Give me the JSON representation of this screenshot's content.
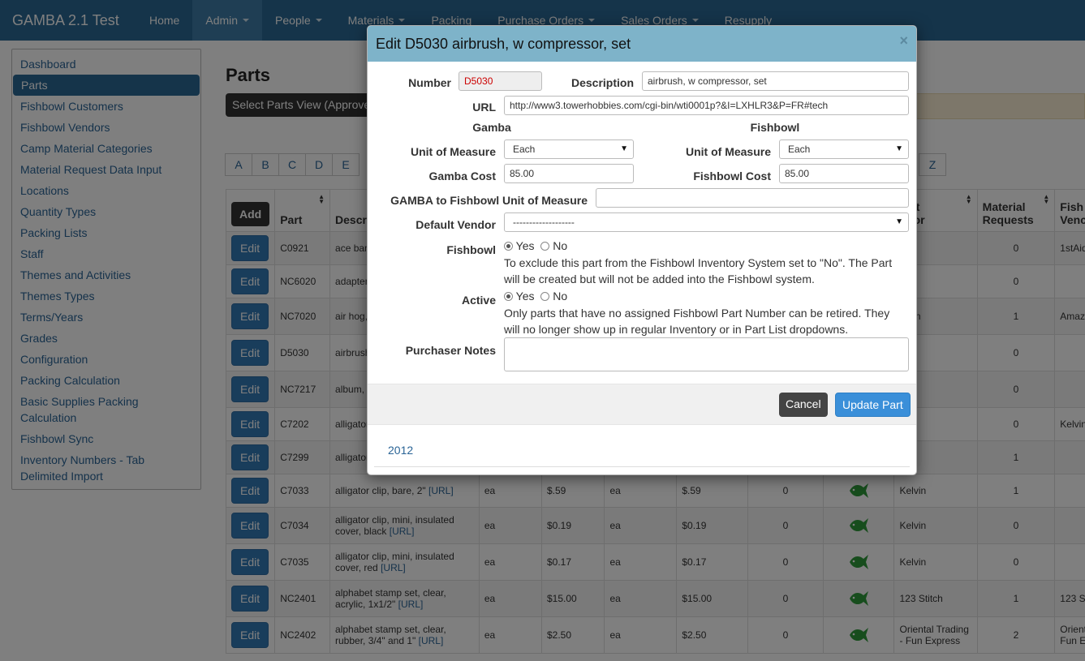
{
  "app": {
    "title": "GAMBA 2.1 Test"
  },
  "nav": [
    {
      "label": "Home",
      "caret": false,
      "active": false
    },
    {
      "label": "Admin",
      "caret": true,
      "active": true
    },
    {
      "label": "People",
      "caret": true,
      "active": false
    },
    {
      "label": "Materials",
      "caret": true,
      "active": false
    },
    {
      "label": "Packing",
      "caret": false,
      "active": false
    },
    {
      "label": "Purchase Orders",
      "caret": true,
      "active": false
    },
    {
      "label": "Sales Orders",
      "caret": true,
      "active": false
    },
    {
      "label": "Resupply",
      "caret": false,
      "active": false
    }
  ],
  "sidebar": [
    "Dashboard",
    "Parts",
    "Fishbowl Customers",
    "Fishbowl Vendors",
    "Camp Material Categories",
    "Material Request Data Input",
    "Locations",
    "Quantity Types",
    "Packing Lists",
    "Staff",
    "Themes and Activities",
    "Themes Types",
    "Terms/Years",
    "Grades",
    "Configuration",
    "Packing Calculation",
    "Basic Supplies Packing Calculation",
    "Fishbowl Sync",
    "Inventory Numbers - Tab Delimited Import"
  ],
  "sidebar_active": "Parts",
  "main": {
    "title": "Parts",
    "view_label": "Select Parts View (Approve",
    "letters": [
      "A",
      "B",
      "C",
      "D",
      "E"
    ],
    "letter_last": "Z"
  },
  "table": {
    "add_label": "Add",
    "edit_label": "Edit",
    "url_label": "[URL]",
    "headers": [
      "Part",
      "Descrip",
      "",
      "",
      "",
      "",
      "",
      "",
      "ault\nndor",
      "Material\nRequests",
      "Fish\nVenc"
    ],
    "rows": [
      {
        "part": "C0921",
        "desc": "ace band",
        "u1": "",
        "c1": "",
        "u2": "",
        "c2": "",
        "q": "",
        "fish": false,
        "vendor": "",
        "req": "0",
        "fv": "1stAid"
      },
      {
        "part": "NC6020",
        "desc": "adapter,",
        "u1": "",
        "c1": "",
        "u2": "",
        "c2": "",
        "q": "",
        "fish": false,
        "vendor": "",
        "req": "0",
        "fv": ""
      },
      {
        "part": "NC7020",
        "desc": "air hog, s",
        "u1": "",
        "c1": "",
        "u2": "",
        "c2": "",
        "q": "",
        "fish": false,
        "vendor": "azon",
        "req": "1",
        "fv": "Amaz"
      },
      {
        "part": "D5030",
        "desc": "airbrush,",
        "url": true,
        "u1": "",
        "c1": "",
        "u2": "",
        "c2": "",
        "q": "",
        "fish": false,
        "vendor": "",
        "req": "0",
        "fv": ""
      },
      {
        "part": "NC7217",
        "desc": "album, p",
        "url": true,
        "u1": "",
        "c1": "",
        "u2": "",
        "c2": "",
        "q": "",
        "fish": false,
        "vendor": "",
        "req": "0",
        "fv": ""
      },
      {
        "part": "C7202",
        "desc": "alligator",
        "u1": "",
        "c1": "",
        "u2": "",
        "c2": "",
        "q": "",
        "fish": false,
        "vendor": "",
        "req": "0",
        "fv": "Kelvin"
      },
      {
        "part": "C7299",
        "desc": "alligator",
        "u1": "",
        "c1": "",
        "u2": "",
        "c2": "",
        "q": "",
        "fish": false,
        "vendor": "lvin",
        "req": "1",
        "fv": ""
      },
      {
        "part": "C7033",
        "desc": "alligator clip, bare, 2\"",
        "url": true,
        "u1": "ea",
        "c1": "$.59",
        "u2": "ea",
        "c2": "$.59",
        "q": "0",
        "fish": true,
        "vendor": "Kelvin",
        "req": "1",
        "fv": ""
      },
      {
        "part": "C7034",
        "desc": "alligator clip, mini, insulated cover, black",
        "url": true,
        "u1": "ea",
        "c1": "$0.19",
        "u2": "ea",
        "c2": "$0.19",
        "q": "0",
        "fish": true,
        "vendor": "Kelvin",
        "req": "0",
        "fv": ""
      },
      {
        "part": "C7035",
        "desc": "alligator clip, mini, insulated cover, red",
        "url": true,
        "u1": "ea",
        "c1": "$0.17",
        "u2": "ea",
        "c2": "$0.17",
        "q": "0",
        "fish": true,
        "vendor": "Kelvin",
        "req": "0",
        "fv": ""
      },
      {
        "part": "NC2401",
        "desc": "alphabet stamp set, clear, acrylic, 1x1/2\"",
        "url": true,
        "u1": "ea",
        "c1": "$15.00",
        "u2": "ea",
        "c2": "$15.00",
        "q": "0",
        "fish": true,
        "vendor": "123 Stitch",
        "req": "1",
        "fv": "123 S"
      },
      {
        "part": "NC2402",
        "desc": "alphabet stamp set, clear, rubber, 3/4\" and 1\"",
        "url": true,
        "u1": "ea",
        "c1": "$2.50",
        "u2": "ea",
        "c2": "$2.50",
        "q": "0",
        "fish": true,
        "vendor": "Oriental Trading - Fun Express",
        "req": "2",
        "fv": "Orient Fun E"
      }
    ]
  },
  "modal": {
    "title": "Edit D5030 airbrush, w compressor, set",
    "close": "×",
    "number_label": "Number",
    "number_value": "D5030",
    "description_label": "Description",
    "description_value": "airbrush, w compressor, set",
    "url_label": "URL",
    "url_value": "http://www3.towerhobbies.com/cgi-bin/wti0001p?&I=LXHLR3&P=FR#tech",
    "gamba_heading": "Gamba",
    "fishbowl_heading": "Fishbowl",
    "gamba_uom_label": "Unit of Measure",
    "gamba_uom_value": "Each",
    "fishbowl_uom_label": "Unit of Measure",
    "fishbowl_uom_value": "Each",
    "gamba_cost_label": "Gamba Cost",
    "gamba_cost_value": "85.00",
    "fishbowl_cost_label": "Fishbowl Cost",
    "fishbowl_cost_value": "85.00",
    "conv_label": "GAMBA to Fishbowl Unit of Measure",
    "conv_value": "",
    "vendor_label": "Default Vendor",
    "vendor_value": "-------------------",
    "fishbowl_label": "Fishbowl",
    "fishbowl_yes": "Yes",
    "fishbowl_no": "No",
    "fishbowl_help": "To exclude this part from the Fishbowl Inventory System set to \"No\". The Part will be created but will not be added into the Fishbowl system.",
    "active_label": "Active",
    "active_yes": "Yes",
    "active_no": "No",
    "active_help": "Only parts that have no assigned Fishbowl Part Number can be retired. They will no longer show up in regular Inventory or in Part List dropdowns.",
    "notes_label": "Purchaser Notes",
    "notes_value": "",
    "cancel_label": "Cancel",
    "update_label": "Update Part",
    "year_link": "2012"
  },
  "colors": {
    "navbar": "#2b6894",
    "modal_header": "#7eb3c9",
    "primary": "#337ab7",
    "fish": "#2e9a3a"
  }
}
